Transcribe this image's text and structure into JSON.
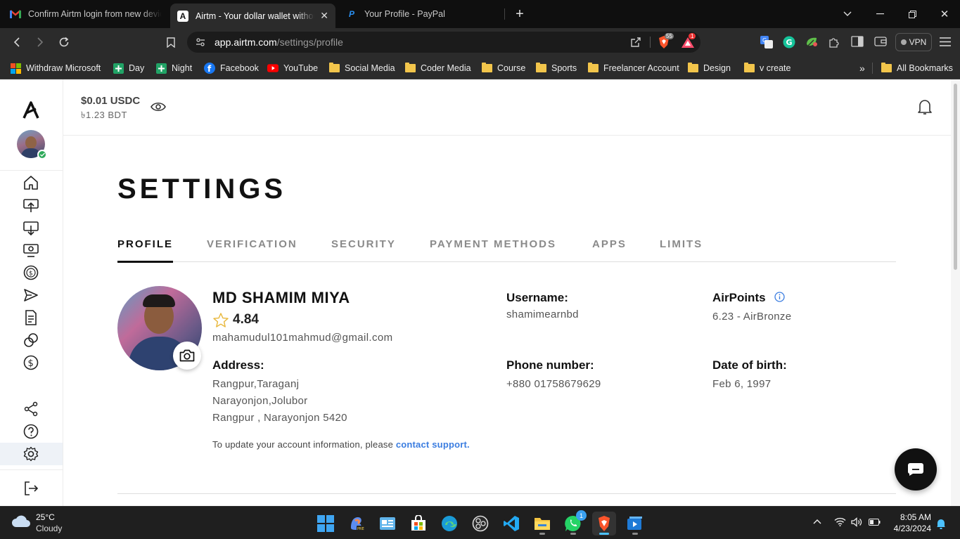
{
  "browser": {
    "tabs": [
      {
        "title": "Confirm Airtm login from new device",
        "favicon": "gmail-icon",
        "active": false
      },
      {
        "title": "Airtm - Your dollar wallet without",
        "favicon": "airtm-icon",
        "active": true
      },
      {
        "title": "Your Profile - PayPal",
        "favicon": "paypal-icon",
        "active": false
      }
    ],
    "url_domain": "app.airtm.com",
    "url_path": "/settings/profile",
    "shield_count": "55",
    "alert_count": "1",
    "vpn_label": "VPN",
    "bookmarks": [
      {
        "label": "Withdraw Microsoft",
        "icon": "microsoft-icon"
      },
      {
        "label": "Day",
        "icon": "plus-green-icon"
      },
      {
        "label": "Night",
        "icon": "plus-green-icon"
      },
      {
        "label": "Facebook",
        "icon": "facebook-icon"
      },
      {
        "label": "YouTube",
        "icon": "youtube-icon"
      },
      {
        "label": "Social Media",
        "icon": "folder-icon"
      },
      {
        "label": "Coder Media",
        "icon": "folder-icon"
      },
      {
        "label": "Course",
        "icon": "folder-icon"
      },
      {
        "label": "Sports",
        "icon": "folder-icon"
      },
      {
        "label": "Freelancer Account",
        "icon": "folder-icon"
      },
      {
        "label": "Design",
        "icon": "folder-icon"
      },
      {
        "label": "v create",
        "icon": "folder-icon"
      }
    ],
    "all_bookmarks_label": "All Bookmarks"
  },
  "header": {
    "balance_usdc": "$0.01 USDC",
    "balance_local": "৳1.23 BDT"
  },
  "settings": {
    "title": "SETTINGS",
    "tabs": [
      "PROFILE",
      "VERIFICATION",
      "SECURITY",
      "PAYMENT METHODS",
      "APPS",
      "LIMITS"
    ]
  },
  "profile": {
    "name": "MD SHAMIM MIYA",
    "rating": "4.84",
    "email": "mahamudul101mahmud@gmail.com",
    "address_label": "Address:",
    "address_lines": [
      "Rangpur,Taraganj",
      "Narayonjon,Jolubor",
      "Rangpur , Narayonjon 5420"
    ],
    "username_label": "Username:",
    "username": "shamimearnbd",
    "phone_label": "Phone number:",
    "phone": "+880 01758679629",
    "airpoints_label": "AirPoints",
    "airpoints": "6.23 - AirBronze",
    "dob_label": "Date of birth:",
    "dob": "Feb 6, 1997",
    "update_note": "To update your account information, please",
    "contact_link": "contact support."
  },
  "taskbar": {
    "weather_temp": "25°C",
    "weather_desc": "Cloudy",
    "time": "8:05 AM",
    "date": "4/23/2024",
    "whatsapp_badge": "1"
  },
  "colors": {
    "accent_blue": "#3b7de0",
    "chat_button": "#111111",
    "verified_green": "#2faa5a"
  }
}
